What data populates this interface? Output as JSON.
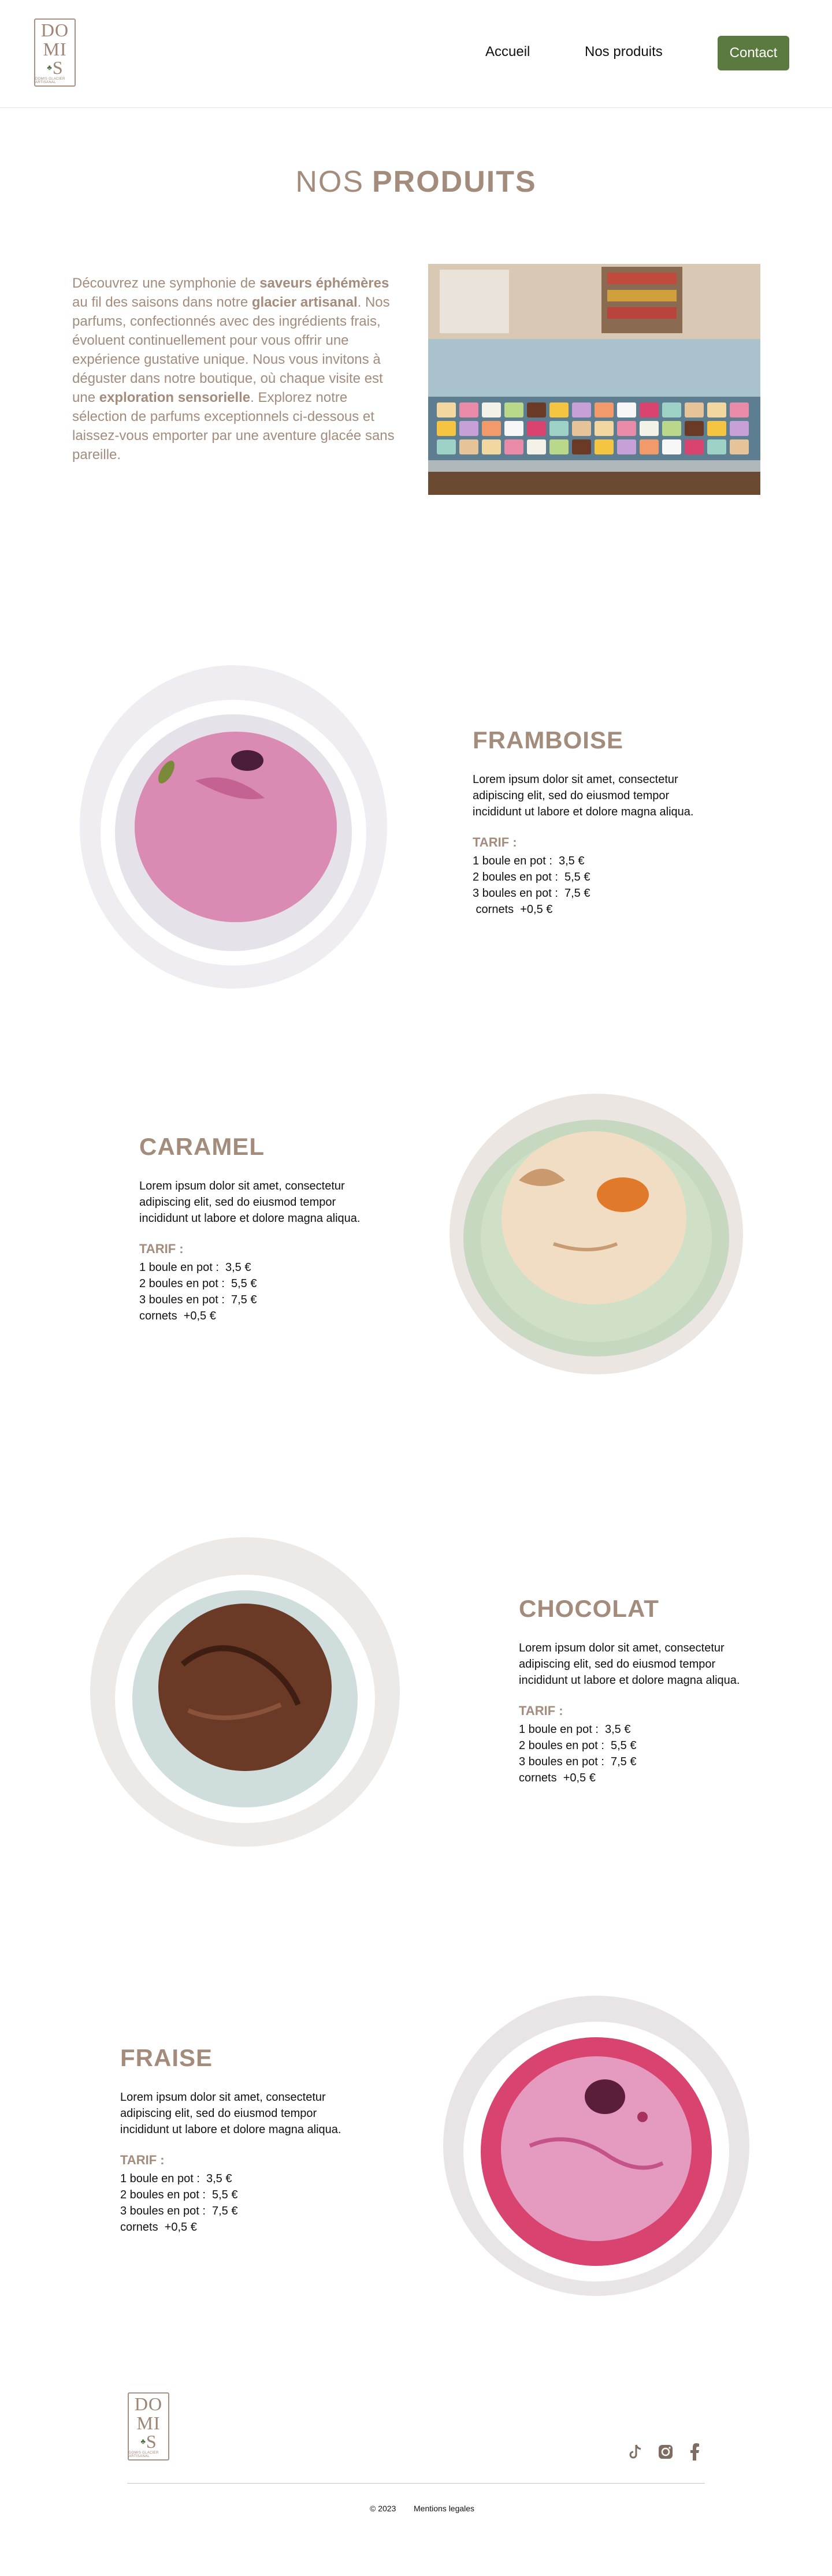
{
  "header": {
    "logo": {
      "line1": "DO",
      "line2": "MI",
      "line3": "S",
      "tagline": "DOMIS GLACIER ARTISANAL"
    },
    "nav": {
      "home": "Accueil",
      "products": "Nos produits",
      "contact": "Contact"
    }
  },
  "hero": {
    "title_light": "NOS",
    "title_bold": "PRODUITS",
    "intro_parts": [
      "Découvrez une symphonie de ",
      "saveurs éphémères",
      " au fil des saisons dans notre ",
      "glacier artisanal",
      ". Nos parfums, confectionnés avec des ingrédients frais, évoluent continuellement pour vous offrir une expérience gustative unique. Nous vous invitons à déguster dans notre boutique, où chaque visite est une ",
      "exploration sensorielle",
      ". Explorez notre sélection de parfums exceptionnels ci-dessous et laissez-vous emporter par une aventure glacée sans pareille."
    ]
  },
  "products": [
    {
      "name": "FRAMBOISE",
      "description": "Lorem ipsum dolor sit amet, consectetur adipiscing elit, sed do eiusmod tempor incididunt ut labore et dolore magna aliqua.",
      "tarif_label": "TARIF :",
      "prices": [
        "1 boule en pot :  3,5 €",
        "2 boules en pot :  5,5 €",
        "3 boules en pot :  7,5 €",
        " cornets  +0,5 €"
      ],
      "colors": {
        "scoop": "#d98bb3",
        "bowl": "#e6e2ea"
      }
    },
    {
      "name": "CARAMEL",
      "description": "Lorem ipsum dolor sit amet, consectetur adipiscing elit, sed do eiusmod tempor incididunt ut labore et dolore magna aliqua.",
      "tarif_label": "TARIF :",
      "prices": [
        "1 boule en pot :  3,5 €",
        "2 boules en pot :  5,5 €",
        "3 boules en pot :  7,5 €",
        "cornets  +0,5 €"
      ],
      "colors": {
        "scoop": "#f1dcc4",
        "bowl": "#cfe0c7"
      }
    },
    {
      "name": "CHOCOLAT",
      "description": "Lorem ipsum dolor sit amet, consectetur adipiscing elit, sed do eiusmod tempor incididunt ut labore et dolore magna aliqua.",
      "tarif_label": "TARIF :",
      "prices": [
        "1 boule en pot :  3,5 €",
        "2 boules en pot :  5,5 €",
        "3 boules en pot :  7,5 €",
        "cornets  +0,5 €"
      ],
      "colors": {
        "scoop": "#6b3a26",
        "bowl": "#cfdedd"
      }
    },
    {
      "name": "FRAISE",
      "description": "Lorem ipsum dolor sit amet, consectetur adipiscing elit, sed do eiusmod tempor incididunt ut labore et dolore magna aliqua.",
      "tarif_label": "TARIF :",
      "prices": [
        "1 boule en pot :  3,5 €",
        "2 boules en pot :  5,5 €",
        "3 boules en pot :  7,5 €",
        "cornets  +0,5 €"
      ],
      "colors": {
        "scoop": "#e59ac0",
        "bowl": "#d9436f"
      }
    }
  ],
  "footer": {
    "copyright": "© 2023",
    "legal": "Mentions legales",
    "social_icons": [
      "tiktok-icon",
      "instagram-icon",
      "facebook-icon"
    ]
  },
  "colors": {
    "accent_brown": "#a38c7c",
    "button_green": "#5b7a3f"
  }
}
